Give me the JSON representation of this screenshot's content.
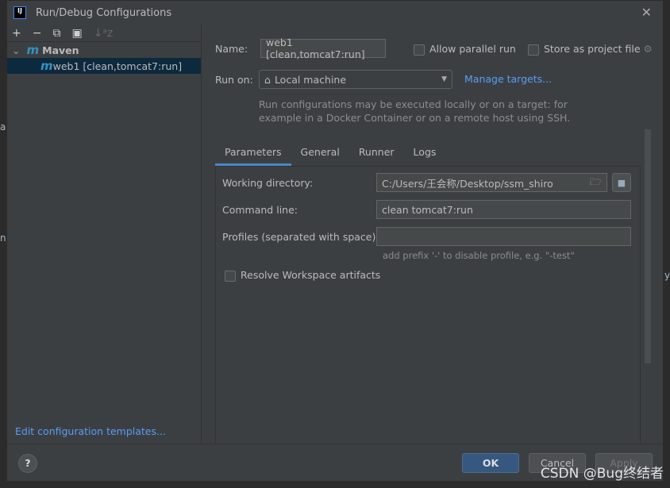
{
  "window": {
    "title": "Run/Debug Configurations",
    "logo_text": "IJ"
  },
  "background": {
    "fragments": [
      "al",
      "nl",
      "y"
    ]
  },
  "toolbar": {
    "add": "+",
    "remove": "−",
    "copy": "⧉",
    "folder": "▣",
    "sort": "↓ᵃz"
  },
  "tree": {
    "group": "Maven",
    "items": [
      {
        "label": "web1 [clean,tomcat7:run]",
        "selected": true
      }
    ]
  },
  "edit_templates": "Edit configuration templates...",
  "form": {
    "name_label": "Name:",
    "name_value": "web1 [clean,tomcat7:run]",
    "allow_parallel": "Allow parallel run",
    "allow_parallel_checked": false,
    "store_project": "Store as project file",
    "store_project_checked": false,
    "run_on_label": "Run on:",
    "run_on_value": "Local machine",
    "manage_targets": "Manage targets...",
    "hint1": "Run configurations may be executed locally or on a target: for",
    "hint2": "example in a Docker Container or on a remote host using SSH."
  },
  "tabs": [
    {
      "label": "Parameters",
      "active": true
    },
    {
      "label": "General"
    },
    {
      "label": "Runner"
    },
    {
      "label": "Logs"
    }
  ],
  "parameters": {
    "working_dir_label": "Working directory:",
    "working_dir_value": "C:/Users/王会称/Desktop/ssm_shiro",
    "command_line_label": "Command line:",
    "command_line_value": "clean tomcat7:run",
    "profiles_label": "Profiles (separated with space):",
    "profiles_value": "",
    "profiles_hint": "add prefix '-' to disable profile, e.g. \"-test\"",
    "resolve_workspace": "Resolve Workspace artifacts",
    "resolve_workspace_checked": false
  },
  "buttons": {
    "help": "?",
    "ok": "OK",
    "cancel": "Cancel",
    "apply": "Apply"
  },
  "watermark": "CSDN @Bug终结者",
  "colors": {
    "accent": "#4a88c7",
    "link": "#589df6",
    "selection": "#0d293e",
    "ok": "#365880"
  }
}
